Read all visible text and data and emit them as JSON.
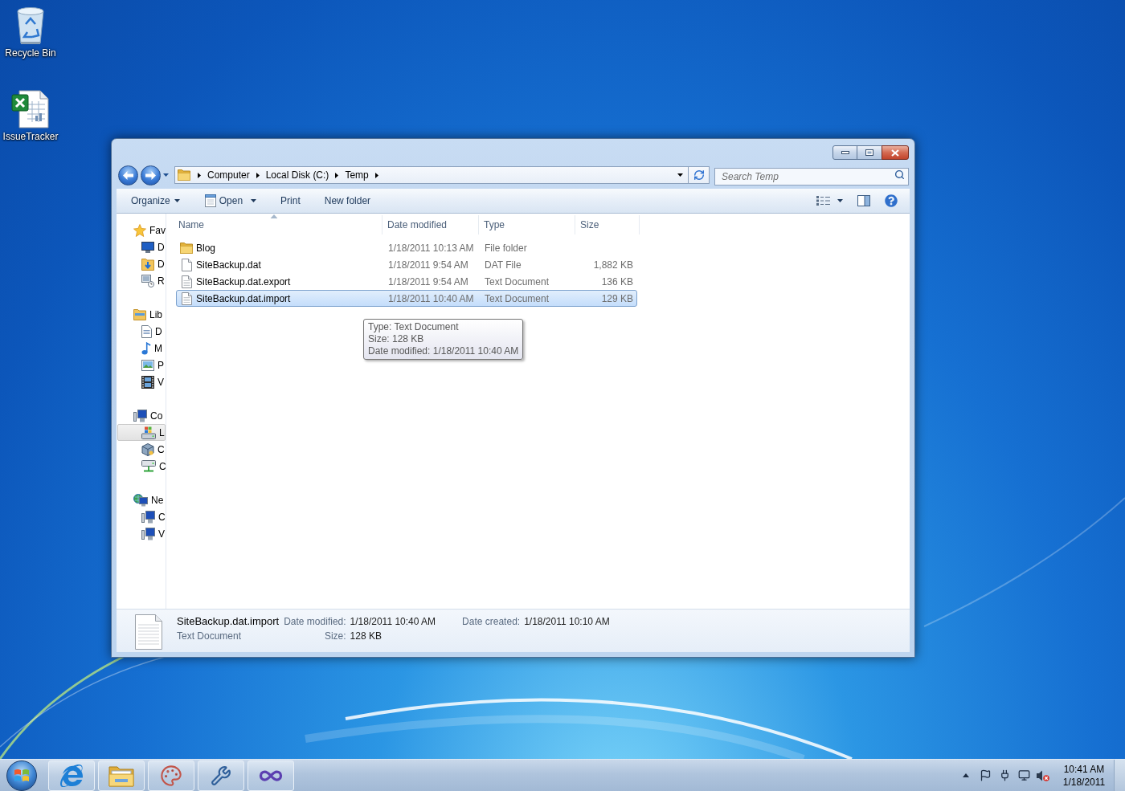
{
  "desktop_icons": [
    {
      "label": "Recycle Bin",
      "kind": "recycle_bin"
    },
    {
      "label": "IssueTracker",
      "kind": "spreadsheet"
    }
  ],
  "window": {
    "address": {
      "crumbs": [
        "Computer",
        "Local Disk (C:)",
        "Temp"
      ]
    },
    "search": {
      "placeholder": "Search Temp"
    },
    "toolbar": [
      {
        "label": "Organize",
        "kind": "menu"
      },
      {
        "label": "Open",
        "kind": "open_with"
      },
      {
        "label": "Print",
        "kind": "command"
      },
      {
        "label": "New folder",
        "kind": "command"
      }
    ],
    "navigation": [
      {
        "label": "Fav",
        "kind": "favorites",
        "selected": false,
        "children": [
          {
            "label": "D",
            "kind": "desktop",
            "selected": false
          },
          {
            "label": "D",
            "kind": "downloads",
            "selected": false
          },
          {
            "label": "R",
            "kind": "recent",
            "selected": false
          }
        ]
      },
      {
        "label": "Lib",
        "kind": "libraries",
        "selected": false,
        "children": [
          {
            "label": "D",
            "kind": "documents",
            "selected": false
          },
          {
            "label": "M",
            "kind": "music",
            "selected": false
          },
          {
            "label": "P",
            "kind": "pictures",
            "selected": false
          },
          {
            "label": "V",
            "kind": "videos",
            "selected": false
          }
        ]
      },
      {
        "label": "Co",
        "kind": "computer",
        "selected": false,
        "children": [
          {
            "label": "L",
            "kind": "local_disk",
            "selected": true
          },
          {
            "label": "C",
            "kind": "virtual_drive",
            "selected": false
          },
          {
            "label": "C",
            "kind": "network_drive",
            "selected": false
          }
        ]
      },
      {
        "label": "Ne",
        "kind": "network",
        "selected": false,
        "children": [
          {
            "label": "C",
            "kind": "pc",
            "selected": false
          },
          {
            "label": "V",
            "kind": "pc",
            "selected": false
          }
        ]
      }
    ],
    "columns": [
      {
        "label": "Name",
        "sorted": true
      },
      {
        "label": "Date modified",
        "sorted": false
      },
      {
        "label": "Type",
        "sorted": false
      },
      {
        "label": "Size",
        "sorted": false
      }
    ],
    "files": [
      {
        "name": "Blog",
        "date_modified": "1/18/2011 10:13 AM",
        "type": "File folder",
        "kind": "folder",
        "selected": false
      },
      {
        "name": "SiteBackup.dat",
        "date_modified": "1/18/2011 9:54 AM",
        "type": "DAT File",
        "size": "1,882 KB",
        "kind": "file",
        "selected": false
      },
      {
        "name": "SiteBackup.dat.export",
        "date_modified": "1/18/2011 9:54 AM",
        "type": "Text Document",
        "size": "136 KB",
        "kind": "text",
        "selected": false
      },
      {
        "name": "SiteBackup.dat.import",
        "date_modified": "1/18/2011 10:40 AM",
        "type": "Text Document",
        "size": "129 KB",
        "kind": "text",
        "selected": true
      }
    ],
    "tooltip": {
      "lines": [
        "Type: Text Document",
        "Size: 128 KB",
        "Date modified: 1/18/2011 10:40 AM"
      ]
    },
    "details": {
      "name": "SiteBackup.dat.import",
      "type": "Text Document",
      "kind": "text",
      "property_columns": [
        [
          {
            "label": "Date modified:",
            "value": "1/18/2011 10:40 AM"
          },
          {
            "label": "Size:",
            "value": "128 KB"
          }
        ],
        [
          {
            "label": "Date created:",
            "value": "1/18/2011 10:10 AM"
          }
        ]
      ]
    }
  },
  "taskbar": {
    "clock": {
      "time": "10:41 AM",
      "date": "1/18/2011"
    }
  }
}
